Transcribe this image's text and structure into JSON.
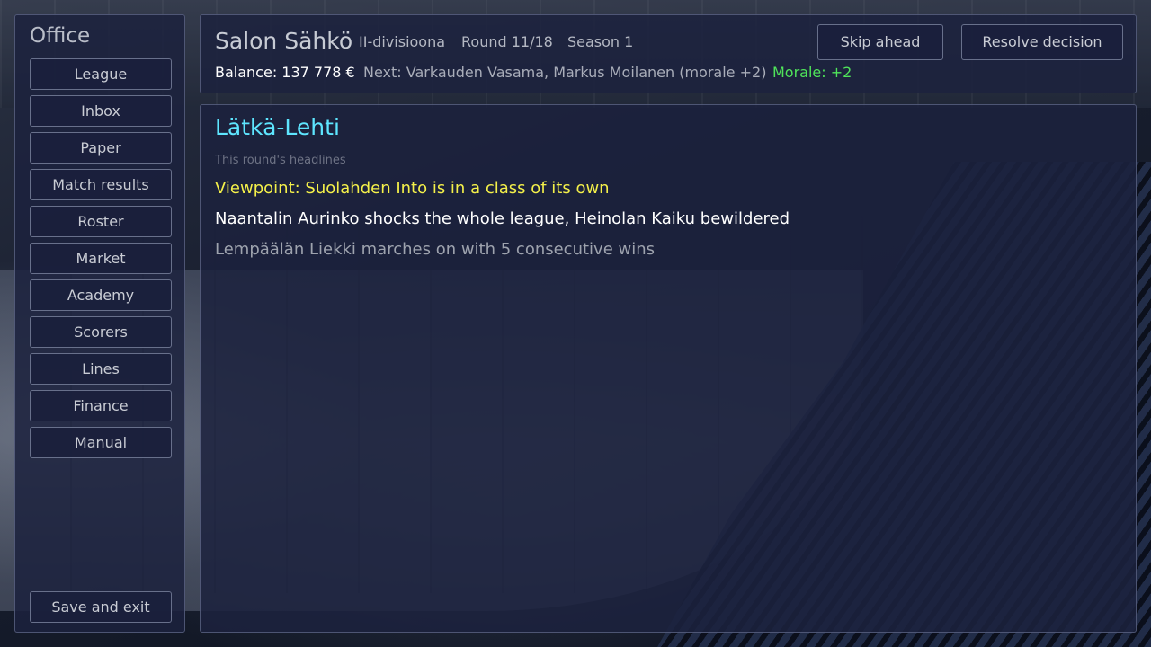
{
  "sidebar": {
    "title": "Office",
    "items": [
      {
        "label": "League"
      },
      {
        "label": "Inbox"
      },
      {
        "label": "Paper"
      },
      {
        "label": "Match results"
      },
      {
        "label": "Roster"
      },
      {
        "label": "Market"
      },
      {
        "label": "Academy"
      },
      {
        "label": "Scorers"
      },
      {
        "label": "Lines"
      },
      {
        "label": "Finance"
      },
      {
        "label": "Manual"
      }
    ],
    "save_label": "Save and exit"
  },
  "header": {
    "team_name": "Salon Sähkö",
    "division": "II-divisioona",
    "round": "Round 11/18",
    "season": "Season 1",
    "balance": "Balance: 137 778 €",
    "next": "Next: Varkauden Vasama, Markus Moilanen (morale +2)",
    "morale": "Morale: +2",
    "skip_label": "Skip ahead",
    "resolve_label": "Resolve decision"
  },
  "main": {
    "title": "Lätkä-Lehti",
    "subtitle": "This round's headlines",
    "headlines": [
      {
        "text": "Viewpoint: Suolahden Into is in a class of its own",
        "color": "#f4f04a"
      },
      {
        "text": "Naantalin Aurinko shocks the whole league, Heinolan Kaiku bewildered",
        "color": "#ffffff"
      },
      {
        "text": "Lempäälän Liekki marches on with 5 consecutive wins",
        "color": "#9ea3ae"
      }
    ]
  },
  "colors": {
    "accent_title": "#5ee6ff",
    "morale_positive": "#4fe35a",
    "panel_bg": "#1c223e"
  }
}
